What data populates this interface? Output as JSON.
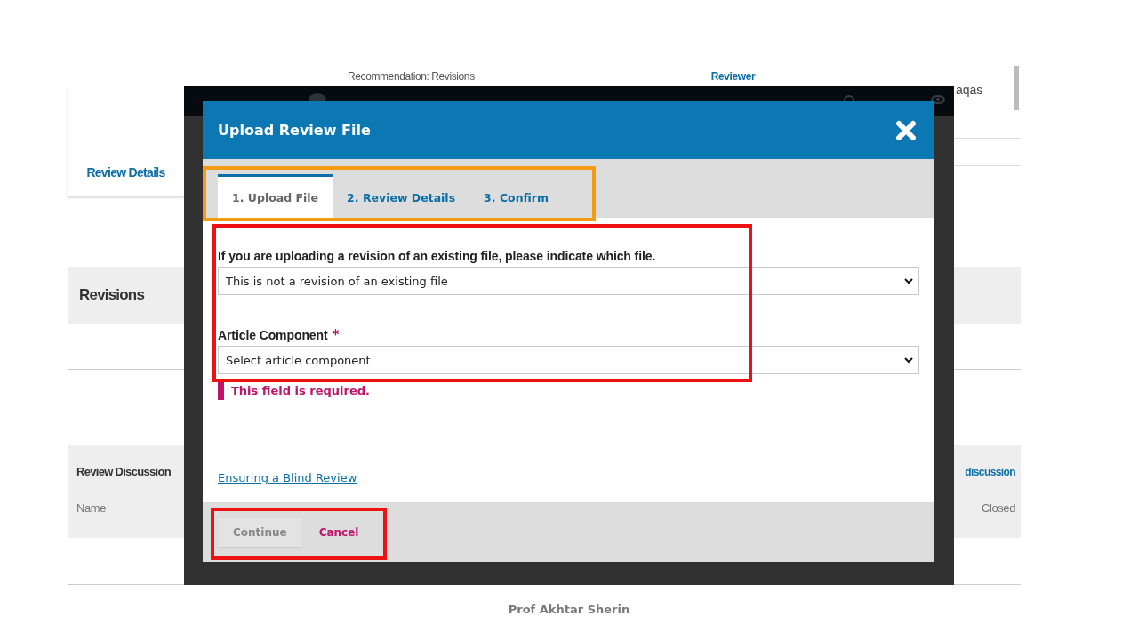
{
  "background_page": {
    "header": {
      "recommendation": "Recommendation: Revisions",
      "reviewer_link": "Reviewer",
      "user_name_fragment": "aqas"
    },
    "review_details_link": "Review Details",
    "revisions": {
      "title": "Revisions"
    },
    "review_discussion": {
      "title": "Review Discussion",
      "add_link_fragment": "discussion",
      "columns": [
        "Name",
        "Closed"
      ]
    }
  },
  "dialog": {
    "title": "Upload Review File",
    "tabs": [
      {
        "label": "1. Upload File",
        "selected": true
      },
      {
        "label": "2. Review Details",
        "selected": false
      },
      {
        "label": "3. Confirm",
        "selected": false
      }
    ],
    "fields": [
      {
        "label": "If you are uploading a revision of an existing file, please indicate which file.",
        "value": "This is not a revision of an existing file"
      },
      {
        "label": "Article Component",
        "required_mark": "*",
        "value": "Select article component",
        "error": "This field is required."
      }
    ],
    "link": "Ensuring a Blind Review",
    "buttons": [
      {
        "label": "Continue",
        "kind": "primary",
        "disabled": true
      },
      {
        "label": "Cancel",
        "kind": "cancel",
        "disabled": false
      }
    ]
  },
  "annotations": [
    {
      "color": "#f39c12"
    },
    {
      "color": "#ee1111"
    },
    {
      "color": "#ee1111"
    }
  ],
  "footer": "Prof Akhtar Sherin"
}
